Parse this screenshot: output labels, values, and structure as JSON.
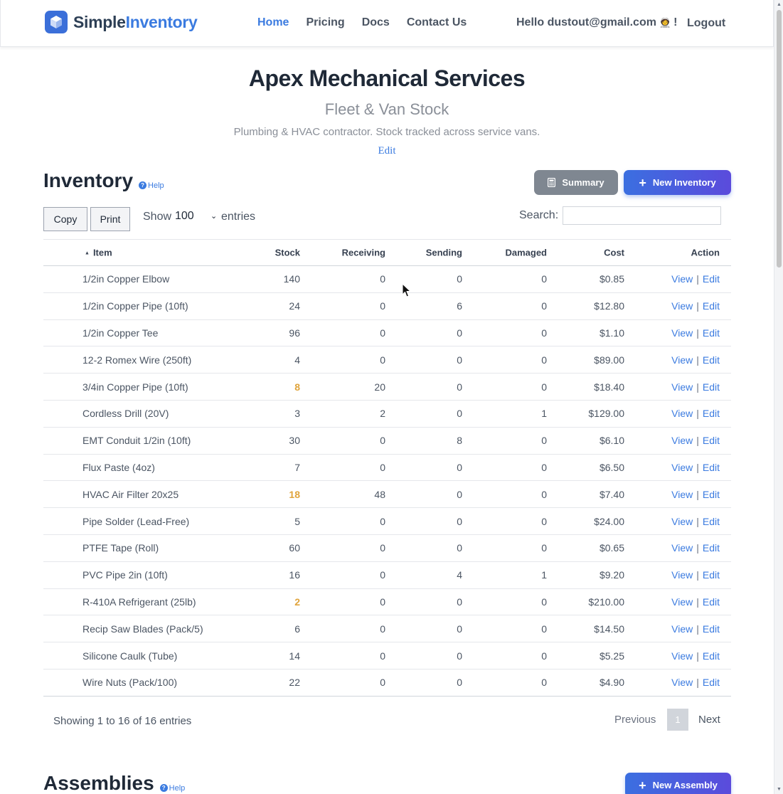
{
  "brand": {
    "part1": "Simple",
    "part2": "Inventory"
  },
  "nav": {
    "items": [
      {
        "label": "Home",
        "active": true
      },
      {
        "label": "Pricing",
        "active": false
      },
      {
        "label": "Docs",
        "active": false
      },
      {
        "label": "Contact Us",
        "active": false
      }
    ],
    "hello": "Hello dustout@gmail.com",
    "hello_suffix": "!",
    "logout": "Logout"
  },
  "header": {
    "company": "Apex Mechanical Services",
    "subtitle": "Fleet & Van Stock",
    "description": "Plumbing & HVAC contractor. Stock tracked across service vans.",
    "edit": "Edit"
  },
  "inventory": {
    "title": "Inventory",
    "help": "Help",
    "summary_label": "Summary",
    "new_label": "New Inventory",
    "copy_label": "Copy",
    "print_label": "Print",
    "show_label": "Show",
    "show_value": "100",
    "entries_label": "entries",
    "search_label": "Search:",
    "search_value": "",
    "columns": [
      "Item",
      "Stock",
      "Receiving",
      "Sending",
      "Damaged",
      "Cost",
      "Action"
    ],
    "rows": [
      {
        "item": "1/2in Copper Elbow",
        "stock": "140",
        "receiving": "0",
        "sending": "0",
        "damaged": "0",
        "cost": "$0.85",
        "low": false
      },
      {
        "item": "1/2in Copper Pipe (10ft)",
        "stock": "24",
        "receiving": "0",
        "sending": "6",
        "damaged": "0",
        "cost": "$12.80",
        "low": false
      },
      {
        "item": "1/2in Copper Tee",
        "stock": "96",
        "receiving": "0",
        "sending": "0",
        "damaged": "0",
        "cost": "$1.10",
        "low": false
      },
      {
        "item": "12-2 Romex Wire (250ft)",
        "stock": "4",
        "receiving": "0",
        "sending": "0",
        "damaged": "0",
        "cost": "$89.00",
        "low": false
      },
      {
        "item": "3/4in Copper Pipe (10ft)",
        "stock": "8",
        "receiving": "20",
        "sending": "0",
        "damaged": "0",
        "cost": "$18.40",
        "low": true
      },
      {
        "item": "Cordless Drill (20V)",
        "stock": "3",
        "receiving": "2",
        "sending": "0",
        "damaged": "1",
        "cost": "$129.00",
        "low": false
      },
      {
        "item": "EMT Conduit 1/2in (10ft)",
        "stock": "30",
        "receiving": "0",
        "sending": "8",
        "damaged": "0",
        "cost": "$6.10",
        "low": false
      },
      {
        "item": "Flux Paste (4oz)",
        "stock": "7",
        "receiving": "0",
        "sending": "0",
        "damaged": "0",
        "cost": "$6.50",
        "low": false
      },
      {
        "item": "HVAC Air Filter 20x25",
        "stock": "18",
        "receiving": "48",
        "sending": "0",
        "damaged": "0",
        "cost": "$7.40",
        "low": true
      },
      {
        "item": "Pipe Solder (Lead-Free)",
        "stock": "5",
        "receiving": "0",
        "sending": "0",
        "damaged": "0",
        "cost": "$24.00",
        "low": false
      },
      {
        "item": "PTFE Tape (Roll)",
        "stock": "60",
        "receiving": "0",
        "sending": "0",
        "damaged": "0",
        "cost": "$0.65",
        "low": false
      },
      {
        "item": "PVC Pipe 2in (10ft)",
        "stock": "16",
        "receiving": "0",
        "sending": "4",
        "damaged": "1",
        "cost": "$9.20",
        "low": false
      },
      {
        "item": "R-410A Refrigerant (25lb)",
        "stock": "2",
        "receiving": "0",
        "sending": "0",
        "damaged": "0",
        "cost": "$210.00",
        "low": true
      },
      {
        "item": "Recip Saw Blades (Pack/5)",
        "stock": "6",
        "receiving": "0",
        "sending": "0",
        "damaged": "0",
        "cost": "$14.50",
        "low": false
      },
      {
        "item": "Silicone Caulk (Tube)",
        "stock": "14",
        "receiving": "0",
        "sending": "0",
        "damaged": "0",
        "cost": "$5.25",
        "low": false
      },
      {
        "item": "Wire Nuts (Pack/100)",
        "stock": "22",
        "receiving": "0",
        "sending": "0",
        "damaged": "0",
        "cost": "$4.90",
        "low": false
      }
    ],
    "action_view": "View",
    "action_sep": "|",
    "action_edit": "Edit",
    "showing": "Showing 1 to 16 of 16 entries",
    "prev": "Previous",
    "page": "1",
    "next": "Next"
  },
  "assemblies": {
    "title": "Assemblies",
    "help": "Help",
    "new_label": "New Assembly"
  },
  "colors": {
    "accent": "#3b7be0",
    "low_stock": "#e0a43c",
    "summary_bg": "#7f8791"
  }
}
